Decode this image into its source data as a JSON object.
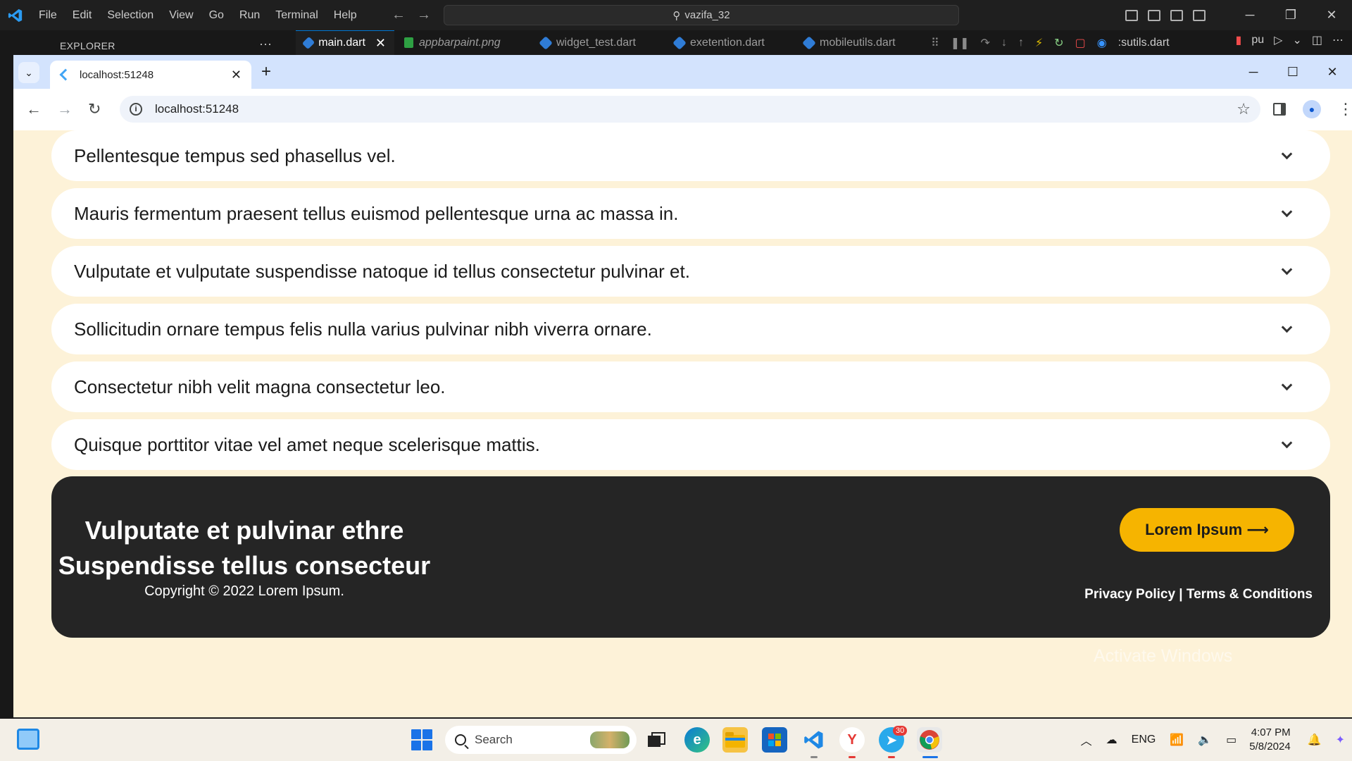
{
  "vscode": {
    "menu": [
      "File",
      "Edit",
      "Selection",
      "View",
      "Go",
      "Run",
      "Terminal",
      "Help"
    ],
    "search_text": "vazifa_32",
    "explorer_label": "EXPLORER",
    "explorer_more": "···",
    "tabs": [
      {
        "label": "main.dart",
        "active": true
      },
      {
        "label": "appbarpaint.png",
        "active": false
      },
      {
        "label": "widget_test.dart",
        "active": false
      },
      {
        "label": "exetention.dart",
        "active": false
      },
      {
        "label": "mobileutils.dart",
        "active": false
      },
      {
        "label": ":sutils.dart",
        "active": false
      },
      {
        "label": "pu",
        "active": false
      }
    ]
  },
  "chrome": {
    "tab_title": "localhost:51248",
    "url": "localhost:51248"
  },
  "page": {
    "faq_items": [
      "Pellentesque tempus sed phasellus vel.",
      "Mauris fermentum praesent tellus euismod pellentesque urna ac massa in.",
      "Vulputate et vulputate suspendisse natoque id tellus consectetur pulvinar et.",
      "Sollicitudin ornare tempus felis nulla varius pulvinar nibh viverra ornare.",
      "Consectetur nibh velit magna consectetur leo.",
      "Quisque porttitor vitae vel amet neque scelerisque mattis."
    ],
    "footer": {
      "title_line1": "Vulputate et pulvinar ethre",
      "title_line2": "Suspendisse tellus consecteur",
      "copyright": "Copyright © 2022 Lorem Ipsum.",
      "button_label": "Lorem Ipsum ⟶",
      "links": "Privacy Policy | Terms & Conditions",
      "accent_color": "#f6b400"
    }
  },
  "watermark": {
    "title": "Activate Windows"
  },
  "taskbar": {
    "search_placeholder": "Search",
    "telegram_badge": "30",
    "lang": "ENG",
    "time": "4:07 PM",
    "date": "5/8/2024"
  }
}
